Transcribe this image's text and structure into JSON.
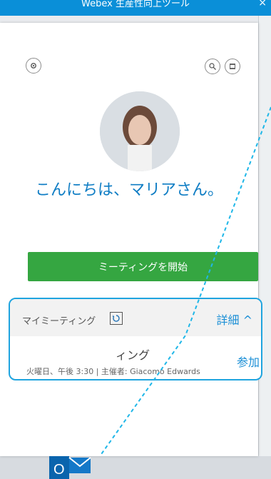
{
  "window": {
    "title": "Webex 生産性向上ツール",
    "close": "×"
  },
  "panel": {
    "greeting": "こんにちは、マリアさん。",
    "start_meeting_label": "ミーティングを開始"
  },
  "meetings": {
    "header_label": "マイミーティング",
    "details_label": "詳細 ^",
    "item": {
      "title": "ィング",
      "meta": "火曜日、午後 3:30 | 主催者: Giacomo Edwards",
      "join_label": "参加"
    }
  },
  "icons": {
    "settings": "gear-icon",
    "search": "search-icon",
    "calendar": "calendar-icon",
    "refresh": "refresh-icon",
    "outlook": "outlook-icon"
  },
  "colors": {
    "titlebar": "#0a8fd8",
    "greeting": "#0f7dc4",
    "start_button": "#35a641",
    "highlight": "#1fa4df",
    "link": "#1b8fd6"
  }
}
